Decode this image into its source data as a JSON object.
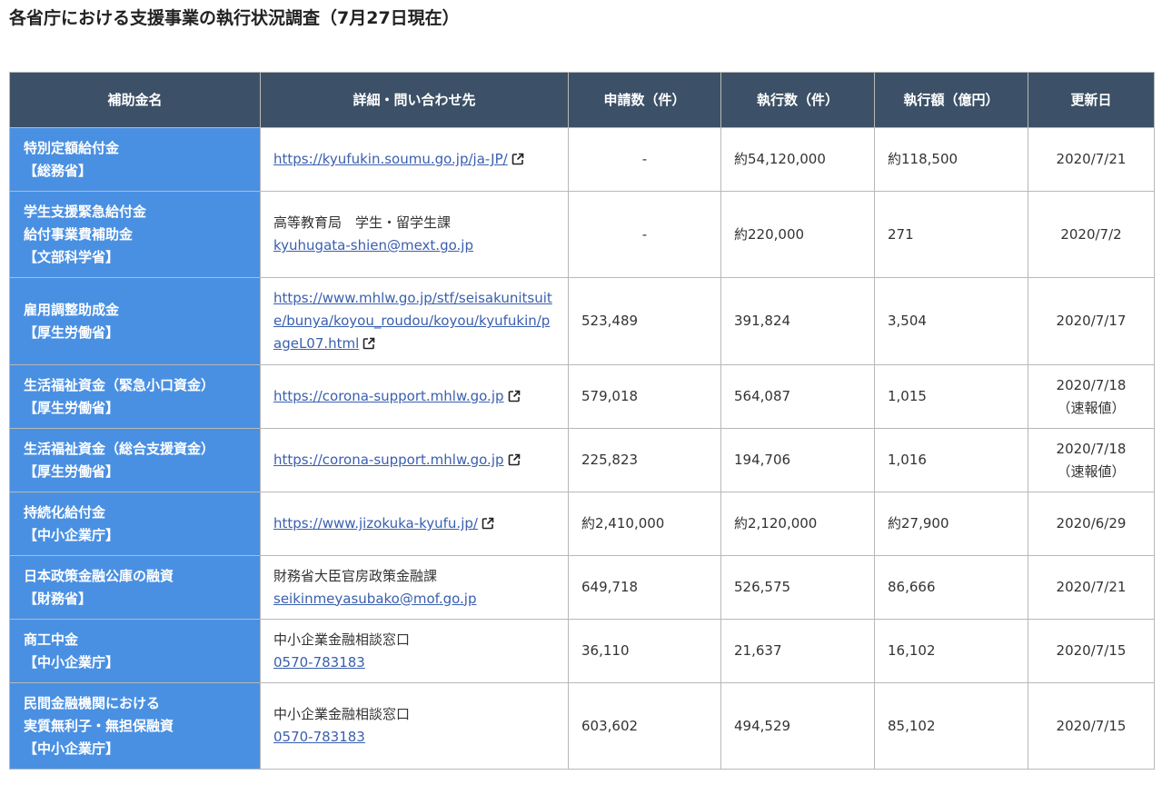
{
  "page": {
    "title": "各省庁における支援事業の執行状況調査（7月27日現在）"
  },
  "table": {
    "headers": [
      "補助金名",
      "詳細・問い合わせ先",
      "申請数（件）",
      "執行数（件）",
      "執行額（億円）",
      "更新日"
    ],
    "rows": [
      {
        "name_lines": [
          "特別定額給付金",
          "【総務省】"
        ],
        "detail_text": "",
        "detail_link": "https://kyufukin.soumu.go.jp/ja-JP/",
        "external": true,
        "applications": "-",
        "executions": "約54,120,000",
        "amount": "約118,500",
        "updated": "2020/7/21",
        "updated_note": ""
      },
      {
        "name_lines": [
          "学生支援緊急給付金",
          "給付事業費補助金",
          "【文部科学省】"
        ],
        "detail_text": "高等教育局　学生・留学生課",
        "detail_link": "kyuhugata-shien@mext.go.jp",
        "external": false,
        "applications": "-",
        "executions": "約220,000",
        "amount": "271",
        "updated": "2020/7/2",
        "updated_note": ""
      },
      {
        "name_lines": [
          "雇用調整助成金",
          "【厚生労働省】"
        ],
        "detail_text": "",
        "detail_link": "https://www.mhlw.go.jp/stf/seisakunitsuite/bunya/koyou_roudou/koyou/kyufukin/pageL07.html",
        "external": true,
        "applications": "523,489",
        "executions": "391,824",
        "amount": "3,504",
        "updated": "2020/7/17",
        "updated_note": ""
      },
      {
        "name_lines": [
          "生活福祉資金（緊急小口資金）",
          "【厚生労働省】"
        ],
        "detail_text": "",
        "detail_link": "https://corona-support.mhlw.go.jp",
        "external": true,
        "applications": "579,018",
        "executions": "564,087",
        "amount": "1,015",
        "updated": "2020/7/18",
        "updated_note": "（速報値）"
      },
      {
        "name_lines": [
          "生活福祉資金（総合支援資金）",
          "【厚生労働省】"
        ],
        "detail_text": "",
        "detail_link": "https://corona-support.mhlw.go.jp",
        "external": true,
        "applications": "225,823",
        "executions": "194,706",
        "amount": "1,016",
        "updated": "2020/7/18",
        "updated_note": "（速報値）"
      },
      {
        "name_lines": [
          "持続化給付金",
          "【中小企業庁】"
        ],
        "detail_text": "",
        "detail_link": "https://www.jizokuka-kyufu.jp/",
        "external": true,
        "applications": "約2,410,000",
        "executions": "約2,120,000",
        "amount": "約27,900",
        "updated": "2020/6/29",
        "updated_note": ""
      },
      {
        "name_lines": [
          "日本政策金融公庫の融資",
          "【財務省】"
        ],
        "detail_text": "財務省大臣官房政策金融課",
        "detail_link": "seikinmeyasubako@mof.go.jp",
        "external": false,
        "applications": "649,718",
        "executions": "526,575",
        "amount": "86,666",
        "updated": "2020/7/21",
        "updated_note": ""
      },
      {
        "name_lines": [
          "商工中金",
          "【中小企業庁】"
        ],
        "detail_text": "中小企業金融相談窓口",
        "detail_link": "0570-783183",
        "external": false,
        "applications": "36,110",
        "executions": "21,637",
        "amount": "16,102",
        "updated": "2020/7/15",
        "updated_note": ""
      },
      {
        "name_lines": [
          "民間金融機関における",
          "実質無利子・無担保融資",
          "【中小企業庁】"
        ],
        "detail_text": "中小企業金融相談窓口",
        "detail_link": "0570-783183",
        "external": false,
        "applications": "603,602",
        "executions": "494,529",
        "amount": "85,102",
        "updated": "2020/7/15",
        "updated_note": ""
      }
    ]
  },
  "colors": {
    "header_bg": "#3c5167",
    "name_col_bg": "#4a90e2",
    "link": "#3a5fae",
    "border": "#b8b8b8"
  },
  "icons": {
    "external_link": "external-link-icon"
  }
}
